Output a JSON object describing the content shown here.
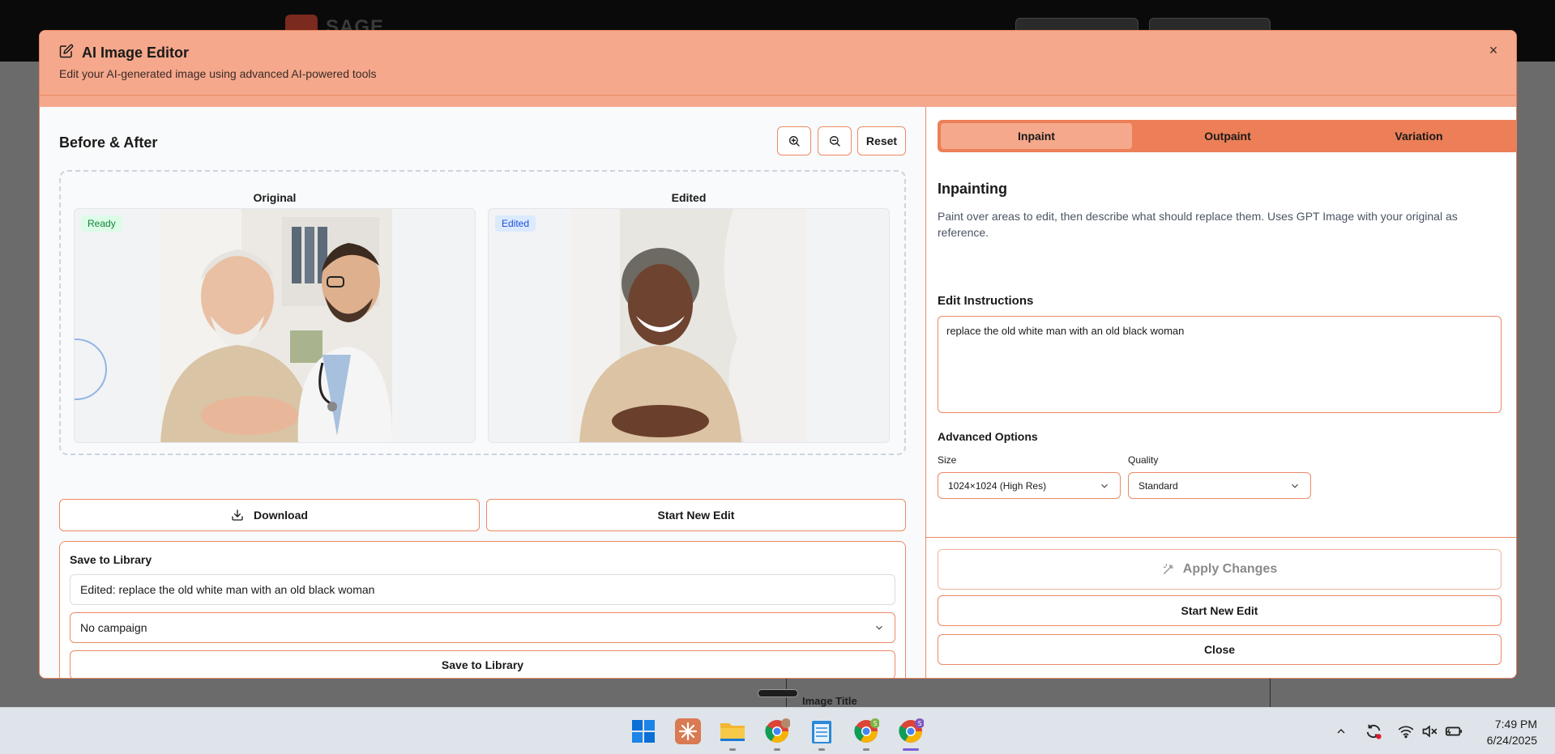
{
  "background_app": {
    "logo_text": "SAGE",
    "panel_title": "Image Title"
  },
  "modal": {
    "title": "AI Image Editor",
    "subtitle": "Edit your AI-generated image using advanced AI-powered tools",
    "close_label": "×"
  },
  "before_after": {
    "title": "Before & After",
    "zoom_in_label": "+",
    "zoom_out_label": "−",
    "reset_label": "Reset",
    "original_label": "Original",
    "edited_label": "Edited",
    "original_badge": "Ready",
    "edited_badge": "Edited"
  },
  "actions": {
    "download_label": "Download",
    "start_new_edit_label": "Start New Edit"
  },
  "save_library": {
    "title": "Save to Library",
    "name_value": "Edited: replace the old white man with an old black woman",
    "campaign_selected": "No campaign",
    "save_button_label": "Save to Library"
  },
  "tabs": [
    {
      "label": "Inpaint",
      "active": true
    },
    {
      "label": "Outpaint",
      "active": false
    },
    {
      "label": "Variation",
      "active": false
    }
  ],
  "inpainting": {
    "title": "Inpainting",
    "description": "Paint over areas to edit, then describe what should replace them. Uses GPT Image with your original as reference.",
    "instructions_label": "Edit Instructions",
    "instructions_value": "replace the old white man with an old black woman",
    "advanced_label": "Advanced Options",
    "size_label": "Size",
    "size_value": "1024×1024 (High Res)",
    "quality_label": "Quality",
    "quality_value": "Standard"
  },
  "footer_actions": {
    "apply_label": "Apply Changes",
    "start_new_edit_label": "Start New Edit",
    "close_label": "Close"
  },
  "taskbar": {
    "time": "7:49 PM",
    "date": "6/24/2025",
    "apps": [
      "windows-start",
      "claude",
      "file-explorer",
      "chrome-profile-1",
      "notepad",
      "chrome-profile-2",
      "chrome-profile-3"
    ]
  },
  "colors": {
    "accent": "#ec7f57",
    "header_bg": "#f5a88c",
    "border": "#ec8a66"
  }
}
